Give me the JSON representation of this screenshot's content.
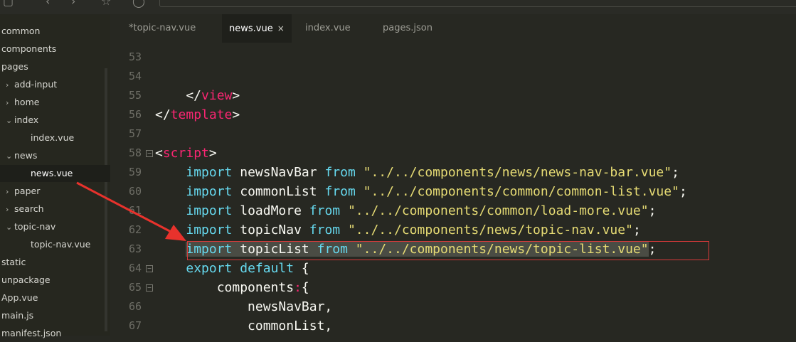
{
  "sidebar": {
    "items": [
      {
        "label": "common",
        "indent": 0,
        "arrow": ""
      },
      {
        "label": "components",
        "indent": 0,
        "arrow": ""
      },
      {
        "label": "pages",
        "indent": 0,
        "arrow": ""
      },
      {
        "label": "add-input",
        "indent": 1,
        "arrow": "›"
      },
      {
        "label": "home",
        "indent": 1,
        "arrow": "›"
      },
      {
        "label": "index",
        "indent": 1,
        "arrow": "⌄"
      },
      {
        "label": "index.vue",
        "indent": 2,
        "arrow": ""
      },
      {
        "label": "news",
        "indent": 1,
        "arrow": "⌄"
      },
      {
        "label": "news.vue",
        "indent": 2,
        "arrow": "",
        "selected": true
      },
      {
        "label": "paper",
        "indent": 1,
        "arrow": "›"
      },
      {
        "label": "search",
        "indent": 1,
        "arrow": "›"
      },
      {
        "label": "topic-nav",
        "indent": 1,
        "arrow": "⌄"
      },
      {
        "label": "topic-nav.vue",
        "indent": 2,
        "arrow": ""
      },
      {
        "label": "static",
        "indent": 0,
        "arrow": ""
      },
      {
        "label": "unpackage",
        "indent": 0,
        "arrow": ""
      },
      {
        "label": "App.vue",
        "indent": 0,
        "arrow": ""
      },
      {
        "label": "main.js",
        "indent": 0,
        "arrow": ""
      },
      {
        "label": "manifest.json",
        "indent": 0,
        "arrow": ""
      }
    ]
  },
  "tabs": [
    {
      "label": "*topic-nav.vue",
      "active": false
    },
    {
      "label": "news.vue",
      "active": true,
      "close": "×"
    },
    {
      "label": "index.vue",
      "active": false
    },
    {
      "label": "pages.json",
      "active": false
    }
  ],
  "lines": [
    {
      "num": "53",
      "fold": "",
      "segs": []
    },
    {
      "num": "54",
      "fold": "",
      "segs": []
    },
    {
      "num": "55",
      "fold": "",
      "segs": [
        {
          "t": "    </",
          "c": "pn"
        },
        {
          "t": "view",
          "c": "tag"
        },
        {
          "t": ">",
          "c": "pn"
        }
      ]
    },
    {
      "num": "56",
      "fold": "",
      "segs": [
        {
          "t": "</",
          "c": "pn"
        },
        {
          "t": "template",
          "c": "tag"
        },
        {
          "t": ">",
          "c": "pn"
        }
      ]
    },
    {
      "num": "57",
      "fold": "",
      "segs": []
    },
    {
      "num": "58",
      "fold": "−",
      "segs": [
        {
          "t": "<",
          "c": "pn"
        },
        {
          "t": "script",
          "c": "tag"
        },
        {
          "t": ">",
          "c": "pn"
        }
      ]
    },
    {
      "num": "59",
      "fold": "",
      "segs": [
        {
          "t": "    ",
          "c": "pn"
        },
        {
          "t": "import",
          "c": "kw"
        },
        {
          "t": " newsNavBar ",
          "c": "pn"
        },
        {
          "t": "from",
          "c": "kw"
        },
        {
          "t": " \"../../components/news/news-nav-bar.vue\"",
          "c": "str"
        },
        {
          "t": ";",
          "c": "pn"
        }
      ]
    },
    {
      "num": "60",
      "fold": "",
      "segs": [
        {
          "t": "    ",
          "c": "pn"
        },
        {
          "t": "import",
          "c": "kw"
        },
        {
          "t": " commonList ",
          "c": "pn"
        },
        {
          "t": "from",
          "c": "kw"
        },
        {
          "t": " \"../../components/common/common-list.vue\"",
          "c": "str"
        },
        {
          "t": ";",
          "c": "pn"
        }
      ]
    },
    {
      "num": "61",
      "fold": "",
      "segs": [
        {
          "t": "    ",
          "c": "pn"
        },
        {
          "t": "import",
          "c": "kw"
        },
        {
          "t": " loadMore ",
          "c": "pn"
        },
        {
          "t": "from",
          "c": "kw"
        },
        {
          "t": " \"../../components/common/load-more.vue\"",
          "c": "str"
        },
        {
          "t": ";",
          "c": "pn"
        }
      ]
    },
    {
      "num": "62",
      "fold": "",
      "segs": [
        {
          "t": "    ",
          "c": "pn"
        },
        {
          "t": "import",
          "c": "kw"
        },
        {
          "t": " topicNav ",
          "c": "pn"
        },
        {
          "t": "from",
          "c": "kw"
        },
        {
          "t": " \"../../components/news/topic-nav.vue\"",
          "c": "str"
        },
        {
          "t": ";",
          "c": "pn"
        }
      ]
    },
    {
      "num": "63",
      "fold": "",
      "segs": [
        {
          "t": "    ",
          "c": "pn"
        },
        {
          "t": "import",
          "c": "kw sel"
        },
        {
          "t": " topicList ",
          "c": "pn sel"
        },
        {
          "t": "from",
          "c": "kw sel"
        },
        {
          "t": " \"../../components/news/topic-list.vue\"",
          "c": "str sel"
        },
        {
          "t": ";",
          "c": "pn"
        }
      ]
    },
    {
      "num": "64",
      "fold": "−",
      "segs": [
        {
          "t": "    ",
          "c": "pn"
        },
        {
          "t": "export",
          "c": "kw"
        },
        {
          "t": " ",
          "c": "pn"
        },
        {
          "t": "default",
          "c": "kw"
        },
        {
          "t": " {",
          "c": "pn"
        }
      ]
    },
    {
      "num": "65",
      "fold": "−",
      "segs": [
        {
          "t": "        components",
          "c": "pn"
        },
        {
          "t": ":",
          "c": "tag"
        },
        {
          "t": "{",
          "c": "pn"
        }
      ]
    },
    {
      "num": "66",
      "fold": "",
      "segs": [
        {
          "t": "            newsNavBar,",
          "c": "pn"
        }
      ]
    },
    {
      "num": "67",
      "fold": "",
      "segs": [
        {
          "t": "            commonList,",
          "c": "pn"
        }
      ]
    }
  ]
}
